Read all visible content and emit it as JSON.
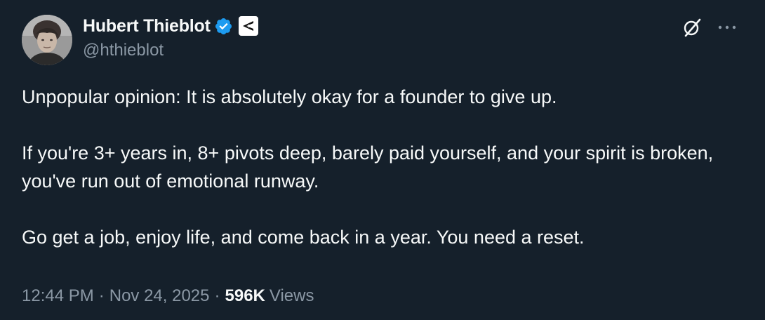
{
  "author": {
    "display_name": "Hubert Thieblot",
    "handle": "@hthieblot",
    "verified_icon": "verified-badge-icon",
    "affiliation_icon": "affiliate-logo-icon"
  },
  "actions": {
    "grok_icon": "grok-icon",
    "more_icon": "more-options-icon"
  },
  "tweet": {
    "paragraphs": [
      "Unpopular opinion: It is absolutely okay for a founder to give up.",
      "If you're 3+ years in, 8+ pivots deep, barely paid yourself, and your spirit is broken, you've run out of emotional runway.",
      "Go get a job, enjoy life, and come back in a year. You need a reset."
    ],
    "time": "12:44 PM",
    "date": "Nov 24, 2025",
    "views_count": "596K",
    "views_label": "Views",
    "separator": "·"
  },
  "colors": {
    "background": "#15202b",
    "text_primary": "#f7f9f9",
    "text_secondary": "#8b98a5",
    "verified_blue": "#1d9bf0"
  }
}
